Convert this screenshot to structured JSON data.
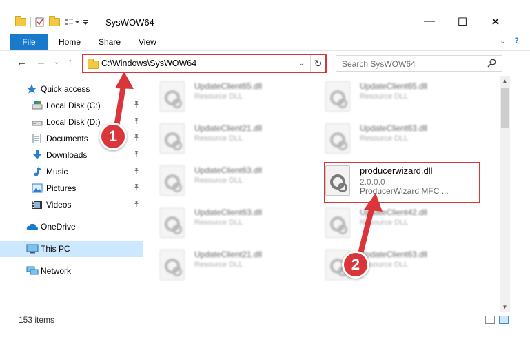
{
  "window": {
    "title": "SysWOW64",
    "controls": {
      "minimize": "—",
      "maximize": "☐",
      "close": "✕"
    }
  },
  "ribbon": {
    "tabs": [
      "File",
      "Home",
      "Share",
      "View"
    ],
    "expand_icon": "⌄",
    "help_icon": "?"
  },
  "address_bar": {
    "path": "C:\\Windows\\SysWOW64",
    "dropdown_glyph": "⌄",
    "refresh_glyph": "↻"
  },
  "nav_buttons": {
    "back": "←",
    "forward": "→",
    "recent": "⌄",
    "up": "↑"
  },
  "search": {
    "placeholder": "Search SysWOW64",
    "icon": "⚲"
  },
  "sidebar": {
    "items": [
      {
        "label": "Quick access",
        "icon": "star-icon",
        "pinned": false
      },
      {
        "label": "Local Disk (C:)",
        "icon": "drive-icon",
        "pinned": true
      },
      {
        "label": "Local Disk (D:)",
        "icon": "drive-icon",
        "pinned": true
      },
      {
        "label": "Documents",
        "icon": "documents-icon",
        "pinned": true
      },
      {
        "label": "Downloads",
        "icon": "downloads-icon",
        "pinned": true
      },
      {
        "label": "Music",
        "icon": "music-icon",
        "pinned": true
      },
      {
        "label": "Pictures",
        "icon": "pictures-icon",
        "pinned": true
      },
      {
        "label": "Videos",
        "icon": "videos-icon",
        "pinned": true
      },
      {
        "label": "OneDrive",
        "icon": "cloud-icon",
        "pinned": false
      },
      {
        "label": "This PC",
        "icon": "computer-icon",
        "pinned": false,
        "selected": true
      },
      {
        "label": "Network",
        "icon": "network-icon",
        "pinned": false
      }
    ],
    "pin_glyph": "📌"
  },
  "files": [
    {
      "name": "UpdateClient65.dll",
      "desc": "Resource DLL"
    },
    {
      "name": "UpdateClient65.dll",
      "desc": "Resource DLL"
    },
    {
      "name": "UpdateClient21.dll",
      "desc": "Resource DLL"
    },
    {
      "name": "UpdateClient63.dll",
      "desc": "Resource DLL"
    },
    {
      "name": "UpdateClient63.dll",
      "desc": "Resource DLL"
    },
    {
      "name": "producerwizard.dll",
      "version": "2.0.0.0",
      "desc": "ProducerWizard MFC ...",
      "selected": true
    },
    {
      "name": "UpdateClient63.dll",
      "desc": "Resource DLL"
    },
    {
      "name": "UpdateClient42.dll",
      "desc": "Resource DLL"
    },
    {
      "name": "UpdateClient21.dll",
      "desc": "Resource DLL"
    },
    {
      "name": "UpdateClient63.dll",
      "desc": "Resource DLL"
    }
  ],
  "status": {
    "item_count": "153 items"
  },
  "annotations": {
    "step1": "1",
    "step2": "2"
  },
  "colors": {
    "accent": "#1979ca",
    "highlight": "#d9353a",
    "selected_bg": "#cce8ff"
  }
}
